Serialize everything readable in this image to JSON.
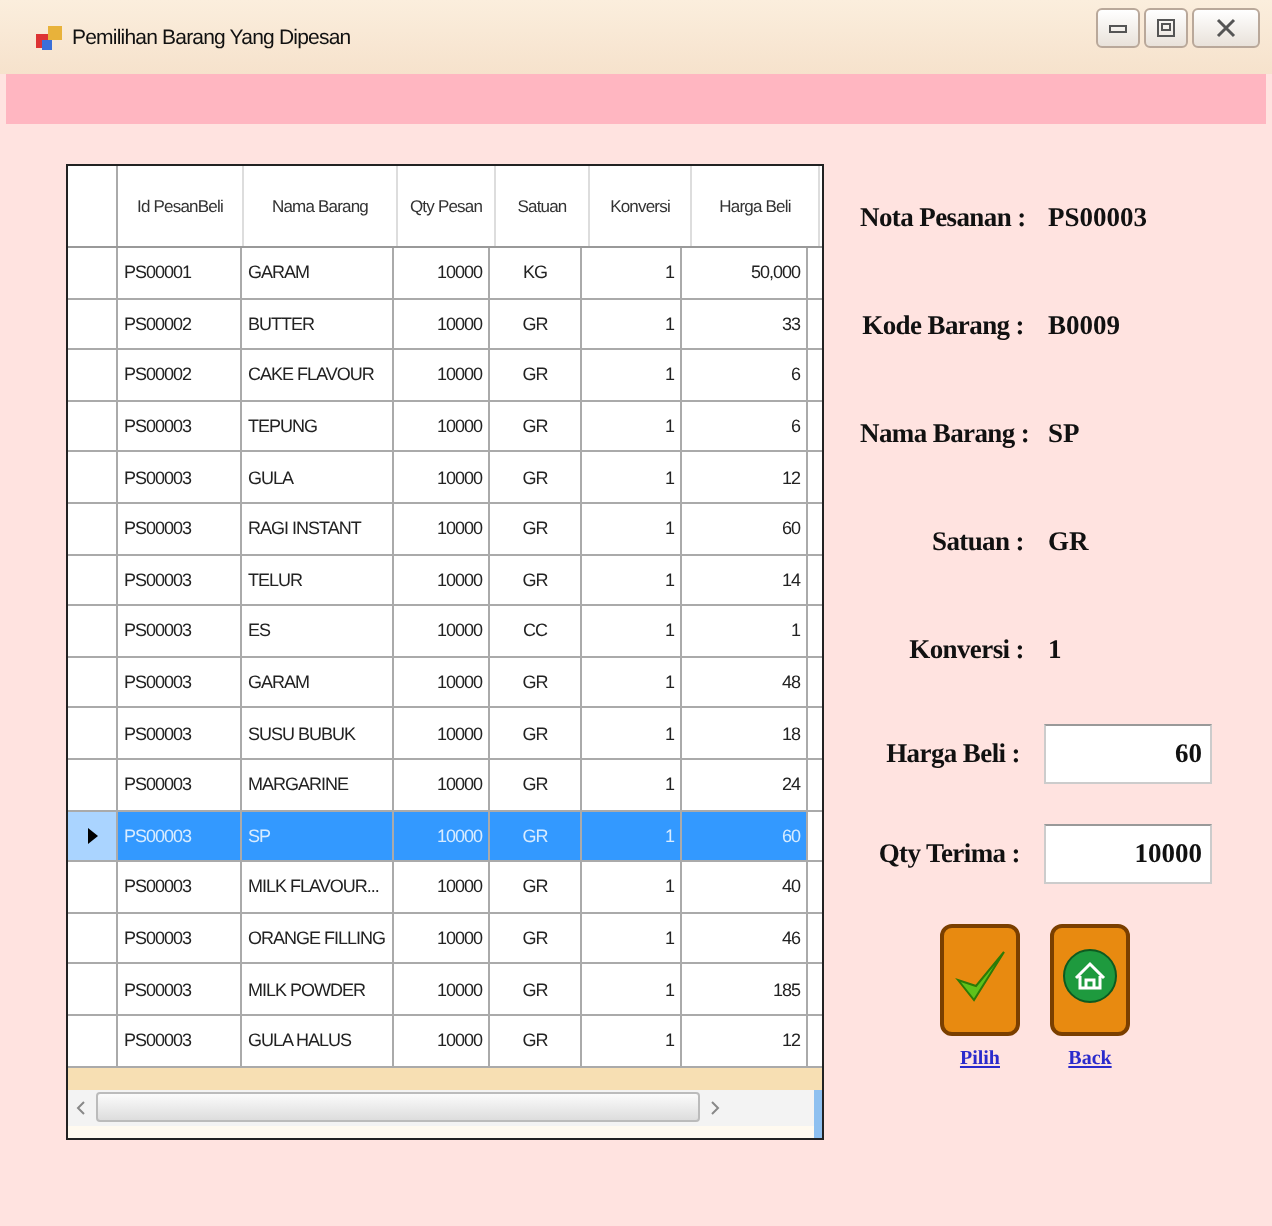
{
  "window": {
    "title": "Pemilihan Barang Yang Dipesan"
  },
  "table": {
    "columns": [
      "Id PesanBeli",
      "Nama Barang",
      "Qty Pesan",
      "Satuan",
      "Konversi",
      "Harga Beli"
    ],
    "rows": [
      {
        "cells": [
          "PS00001",
          "GARAM",
          "10000",
          "KG",
          "1",
          "50,000"
        ],
        "selected": false
      },
      {
        "cells": [
          "PS00002",
          "BUTTER",
          "10000",
          "GR",
          "1",
          "33"
        ],
        "selected": false
      },
      {
        "cells": [
          "PS00002",
          "CAKE FLAVOUR",
          "10000",
          "GR",
          "1",
          "6"
        ],
        "selected": false
      },
      {
        "cells": [
          "PS00003",
          "TEPUNG",
          "10000",
          "GR",
          "1",
          "6"
        ],
        "selected": false
      },
      {
        "cells": [
          "PS00003",
          "GULA",
          "10000",
          "GR",
          "1",
          "12"
        ],
        "selected": false
      },
      {
        "cells": [
          "PS00003",
          "RAGI INSTANT",
          "10000",
          "GR",
          "1",
          "60"
        ],
        "selected": false
      },
      {
        "cells": [
          "PS00003",
          "TELUR",
          "10000",
          "GR",
          "1",
          "14"
        ],
        "selected": false
      },
      {
        "cells": [
          "PS00003",
          "ES",
          "10000",
          "CC",
          "1",
          "1"
        ],
        "selected": false
      },
      {
        "cells": [
          "PS00003",
          "GARAM",
          "10000",
          "GR",
          "1",
          "48"
        ],
        "selected": false
      },
      {
        "cells": [
          "PS00003",
          "SUSU BUBUK",
          "10000",
          "GR",
          "1",
          "18"
        ],
        "selected": false
      },
      {
        "cells": [
          "PS00003",
          "MARGARINE",
          "10000",
          "GR",
          "1",
          "24"
        ],
        "selected": false
      },
      {
        "cells": [
          "PS00003",
          "SP",
          "10000",
          "GR",
          "1",
          "60"
        ],
        "selected": true
      },
      {
        "cells": [
          "PS00003",
          "MILK FLAVOUR...",
          "10000",
          "GR",
          "1",
          "40"
        ],
        "selected": false
      },
      {
        "cells": [
          "PS00003",
          "ORANGE FILLING",
          "10000",
          "GR",
          "1",
          "46"
        ],
        "selected": false
      },
      {
        "cells": [
          "PS00003",
          "MILK POWDER",
          "10000",
          "GR",
          "1",
          "185"
        ],
        "selected": false
      },
      {
        "cells": [
          "PS00003",
          "GULA HALUS",
          "10000",
          "GR",
          "1",
          "12"
        ],
        "selected": false
      }
    ]
  },
  "details": [
    {
      "kind": "text",
      "label": "Nota Pesanan :",
      "value": "PS00003"
    },
    {
      "kind": "text",
      "label": "Kode Barang :",
      "value": "B0009"
    },
    {
      "kind": "text",
      "label": "Nama Barang :",
      "value": "SP"
    },
    {
      "kind": "text",
      "label": "Satuan :",
      "value": "GR"
    },
    {
      "kind": "text",
      "label": "Konversi :",
      "value": "1"
    },
    {
      "kind": "input",
      "label": "Harga Beli :",
      "value": "60"
    },
    {
      "kind": "input",
      "label": "Qty Terima :",
      "value": "10000"
    }
  ],
  "actions": [
    {
      "kind": "check",
      "label": "Pilih"
    },
    {
      "kind": "home",
      "label": "Back"
    }
  ]
}
